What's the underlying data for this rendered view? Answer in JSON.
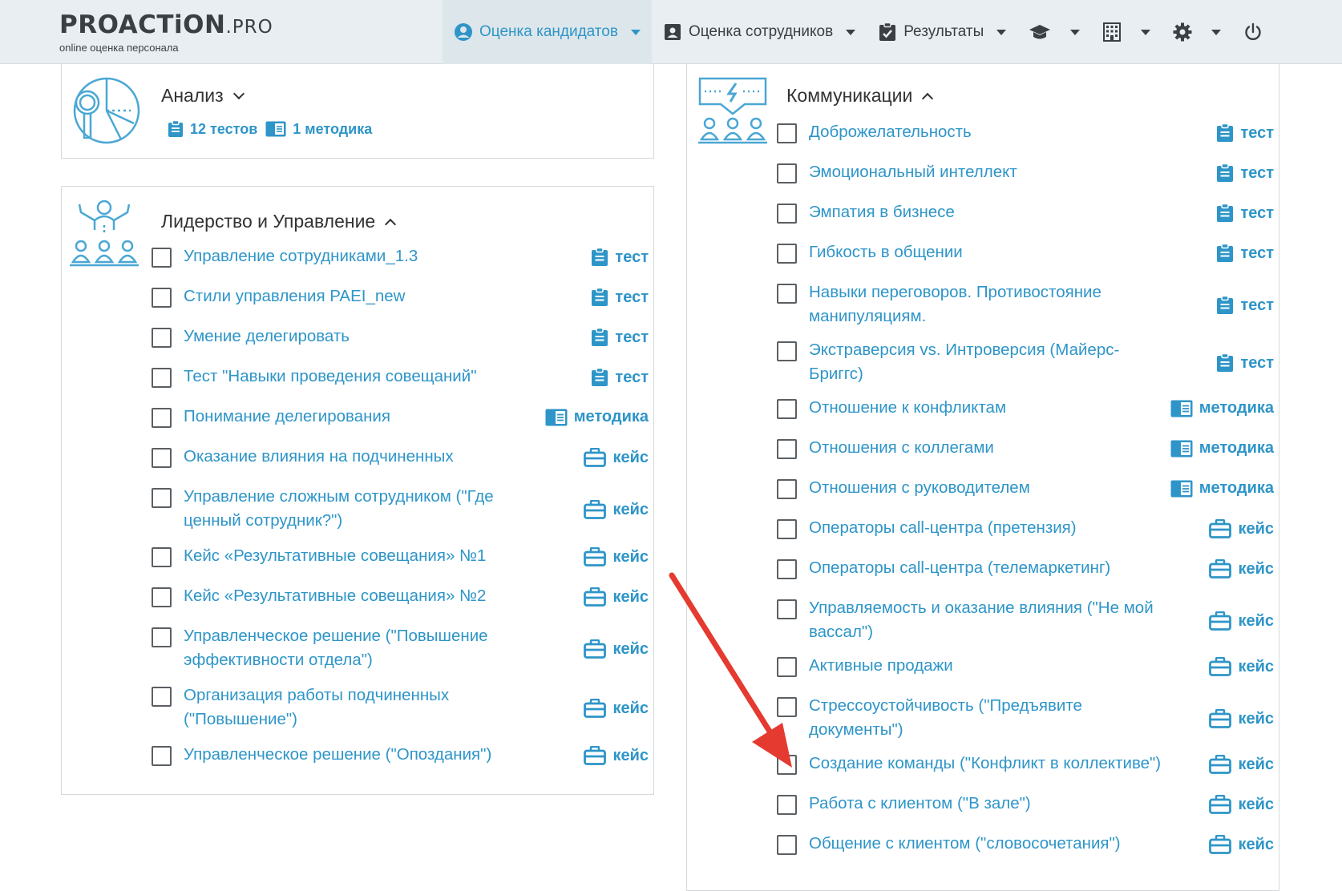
{
  "logo": {
    "main": "PROACTiON",
    "suffix": ".PRO",
    "tagline": "online оценка персонала"
  },
  "nav": {
    "candidates": "Оценка кандидатов",
    "employees": "Оценка сотрудников",
    "results": "Результаты",
    "icons": [
      "user-circle-icon",
      "id-card-icon",
      "clipboard-check-icon",
      "graduation-cap-icon",
      "building-icon",
      "gear-icon",
      "power-icon"
    ]
  },
  "analysis": {
    "title": "Анализ",
    "tests": "12 тестов",
    "methods": "1 методика"
  },
  "leadership": {
    "title": "Лидерство и Управление",
    "items": [
      {
        "label": "Управление сотрудниками_1.3",
        "type": "тест"
      },
      {
        "label": "Стили управления PAEI_new",
        "type": "тест"
      },
      {
        "label": "Умение делегировать",
        "type": "тест"
      },
      {
        "label": "Тест \"Навыки проведения совещаний\"",
        "type": "тест"
      },
      {
        "label": "Понимание делегирования",
        "type": "методика"
      },
      {
        "label": "Оказание влияния на подчиненных",
        "type": "кейс"
      },
      {
        "label": "Управление сложным сотрудником (\"Где",
        "label2": "ценный сотрудник?\")",
        "type": "кейс"
      },
      {
        "label": "Кейс «Результативные совещания» №1",
        "type": "кейс"
      },
      {
        "label": "Кейс «Результативные совещания» №2",
        "type": "кейс"
      },
      {
        "label": "Управленческое решение (\"Повышение",
        "label2": "эффективности отдела\")",
        "type": "кейс"
      },
      {
        "label": "Организация работы подчиненных",
        "label2": "(\"Повышение\")",
        "type": "кейс"
      },
      {
        "label": "Управленческое решение (\"Опоздания\")",
        "type": "кейс"
      }
    ]
  },
  "communication": {
    "title": "Коммуникации",
    "items": [
      {
        "label": "Доброжелательность",
        "type": "тест"
      },
      {
        "label": "Эмоциональный интеллект",
        "type": "тест"
      },
      {
        "label": "Эмпатия в бизнесе",
        "type": "тест"
      },
      {
        "label": "Гибкость в общении",
        "type": "тест"
      },
      {
        "label": "Навыки переговоров. Противостояние",
        "label2": "манипуляциям.",
        "type": "тест"
      },
      {
        "label": "Экстраверсия vs. Интроверсия (Майерс-",
        "label2": "Бриггс)",
        "type": "тест"
      },
      {
        "label": "Отношение к конфликтам",
        "type": "методика"
      },
      {
        "label": "Отношения с коллегами",
        "type": "методика"
      },
      {
        "label": "Отношения с руководителем",
        "type": "методика"
      },
      {
        "label": "Операторы call-центра (претензия)",
        "type": "кейс"
      },
      {
        "label": "Операторы call-центра (телемаркетинг)",
        "type": "кейс"
      },
      {
        "label": "Управляемость и оказание влияния (\"Не мой",
        "label2": "вассал\")",
        "type": "кейс"
      },
      {
        "label": "Активные продажи",
        "type": "кейс"
      },
      {
        "label": "Стрессоустойчивость (\"Предъявите",
        "label2": "документы\")",
        "type": "кейс"
      },
      {
        "label": "Создание команды (\"Конфликт в коллективе\")",
        "type": "кейс"
      },
      {
        "label": "Работа с клиентом (\"В зале\")",
        "type": "кейс"
      },
      {
        "label": "Общение с клиентом (\"словосочетания\")",
        "type": "кейс"
      }
    ]
  },
  "colors": {
    "accent": "#2e95c8",
    "nav_bg": "#e8eef1",
    "arrow": "#e53a30",
    "border": "#d4d9dc"
  }
}
